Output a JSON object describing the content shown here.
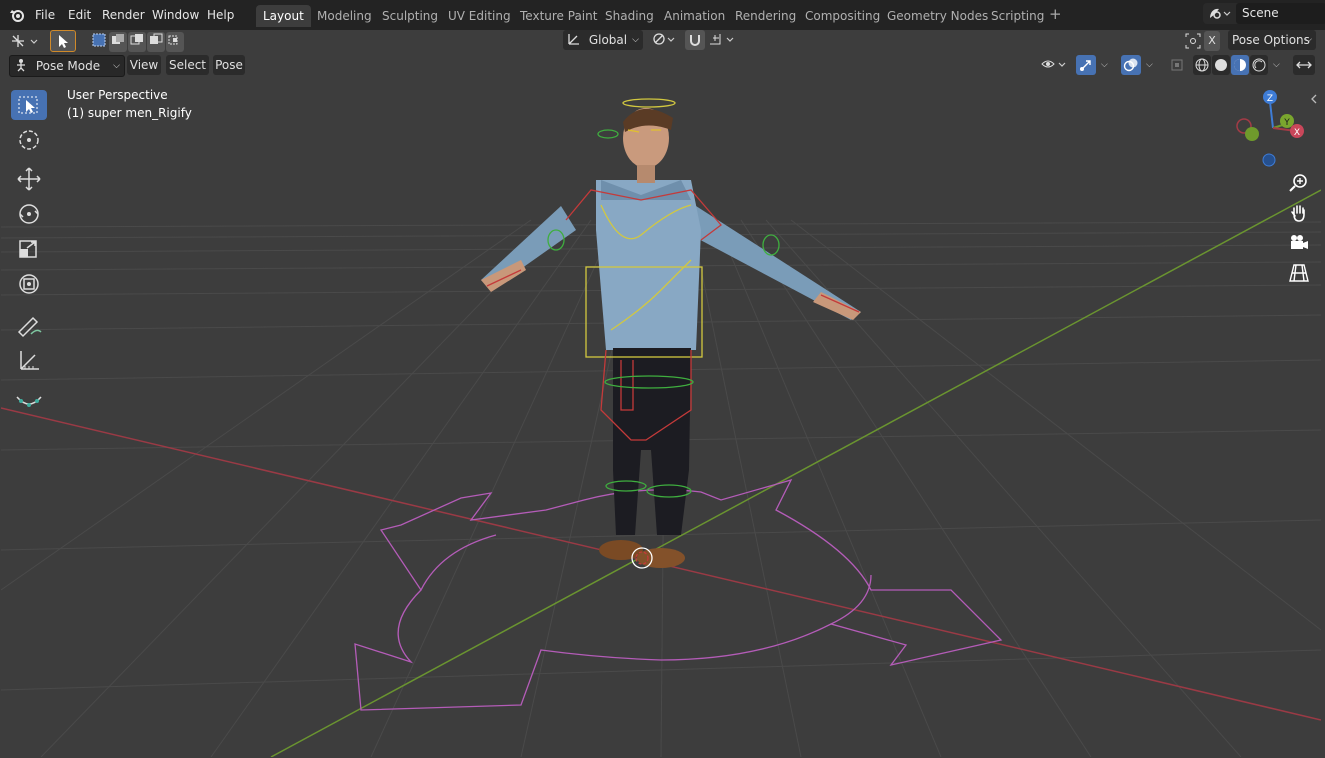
{
  "menu": {
    "items": [
      {
        "label": "File"
      },
      {
        "label": "Edit"
      },
      {
        "label": "Render"
      },
      {
        "label": "Window"
      },
      {
        "label": "Help"
      }
    ]
  },
  "workspaces": [
    {
      "label": "Layout",
      "active": true
    },
    {
      "label": "Modeling"
    },
    {
      "label": "Sculpting"
    },
    {
      "label": "UV Editing"
    },
    {
      "label": "Texture Paint"
    },
    {
      "label": "Shading"
    },
    {
      "label": "Animation"
    },
    {
      "label": "Rendering"
    },
    {
      "label": "Compositing"
    },
    {
      "label": "Geometry Nodes"
    },
    {
      "label": "Scripting"
    }
  ],
  "scene": {
    "name": "Scene"
  },
  "tool_header": {
    "transform_orientation": "Global",
    "pose_options_label": "Pose Options",
    "x_mirror_label": "X"
  },
  "viewport_header": {
    "mode": "Pose Mode",
    "menus": [
      "View",
      "Select",
      "Pose"
    ]
  },
  "viewport": {
    "perspective_label": "User Perspective",
    "object_label": "(1) super men_Rigify",
    "gizmo_axes": {
      "z": "Z",
      "y": "Y",
      "x": "X"
    }
  },
  "colors": {
    "accent": "#4772b3",
    "x_axis": "#a33b46",
    "y_axis": "#6f9a2c",
    "z_axis": "#3e7cd6",
    "root_bone": "#b45cb8",
    "bone_yellow": "#d2c840",
    "bone_red": "#c43a3a",
    "bone_green": "#3fae3f"
  },
  "toolbar_tools": [
    {
      "name": "select-box-tool",
      "icon": "select-box-icon",
      "active": true
    },
    {
      "name": "cursor-tool",
      "icon": "cursor-icon"
    },
    {
      "name": "move-tool",
      "icon": "move-icon"
    },
    {
      "name": "rotate-tool",
      "icon": "rotate-icon"
    },
    {
      "name": "scale-tool",
      "icon": "scale-icon"
    },
    {
      "name": "transform-tool",
      "icon": "transform-icon"
    },
    {
      "name": "annotate-tool",
      "icon": "annotate-icon"
    },
    {
      "name": "measure-tool",
      "icon": "measure-icon"
    },
    {
      "name": "relax-tool",
      "icon": "relax-icon"
    }
  ]
}
